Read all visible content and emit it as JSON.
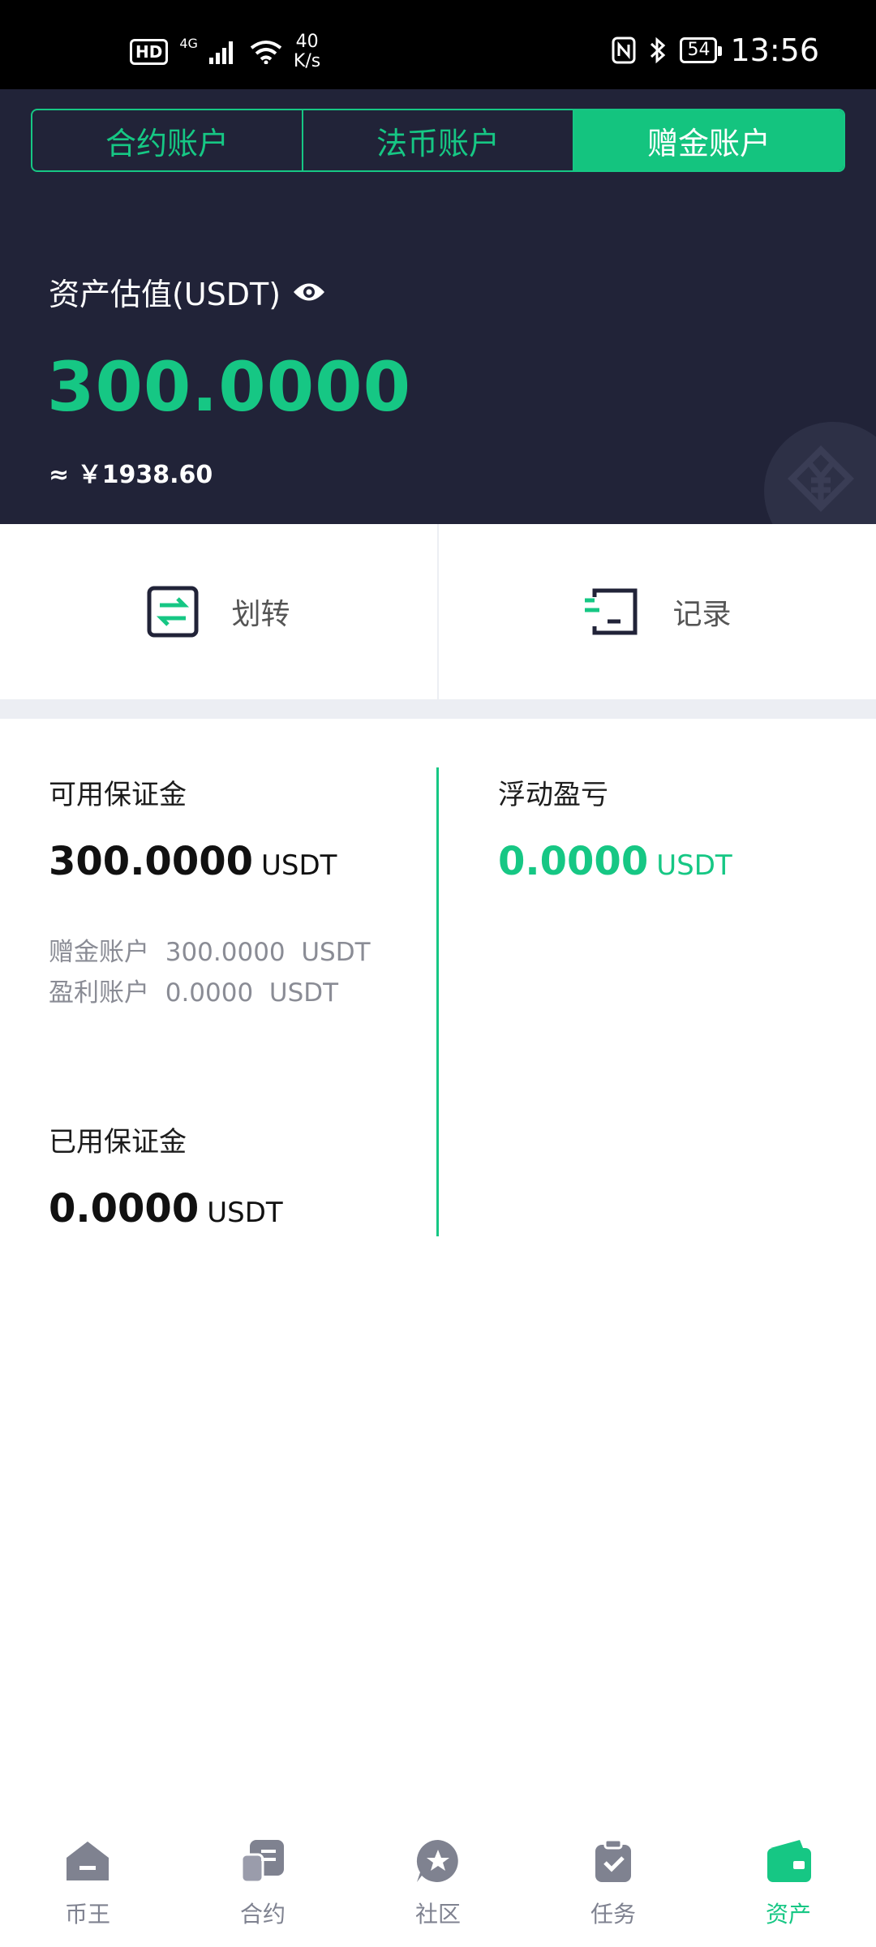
{
  "status_bar": {
    "hd": "HD",
    "network": "4G",
    "speed_value": "40",
    "speed_unit": "K/s",
    "battery": "54",
    "time": "13:56"
  },
  "tabs": [
    {
      "label": "合约账户",
      "active": false
    },
    {
      "label": "法币账户",
      "active": false
    },
    {
      "label": "赠金账户",
      "active": true
    }
  ],
  "estimate": {
    "label": "资产估值(USDT)",
    "value": "300.0000",
    "cny": "≈ ￥1938.60"
  },
  "actions": {
    "transfer_label": "划转",
    "records_label": "记录"
  },
  "details": {
    "available_margin": {
      "label": "可用保证金",
      "value": "300.0000",
      "unit": "USDT"
    },
    "bonus_account": {
      "label": "赠金账户",
      "value": "300.0000",
      "unit": "USDT"
    },
    "profit_account": {
      "label": "盈利账户",
      "value": "0.0000",
      "unit": "USDT"
    },
    "floating_pnl": {
      "label": "浮动盈亏",
      "value": "0.0000",
      "unit": "USDT"
    },
    "used_margin": {
      "label": "已用保证金",
      "value": "0.0000",
      "unit": "USDT"
    }
  },
  "nav": [
    {
      "label": "币王",
      "icon": "home-icon",
      "active": false
    },
    {
      "label": "合约",
      "icon": "contract-icon",
      "active": false
    },
    {
      "label": "社区",
      "icon": "star-icon",
      "active": false
    },
    {
      "label": "任务",
      "icon": "task-icon",
      "active": false
    },
    {
      "label": "资产",
      "icon": "wallet-icon",
      "active": true
    }
  ],
  "colors": {
    "accent": "#16c784",
    "header_bg": "#212338",
    "inactive_icon": "#7f8290"
  }
}
